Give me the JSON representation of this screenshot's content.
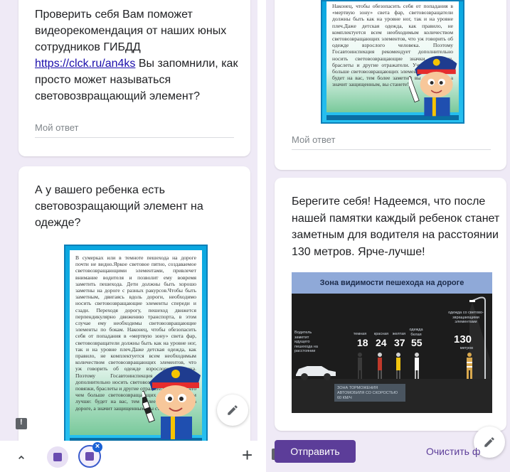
{
  "left_column": {
    "card1": {
      "question_lines": [
        "Проверить себя Вам поможет",
        "видеорекомендация от наших юных",
        "сотрудников ГИБДД"
      ],
      "link": "https://clck.ru/an4ks",
      "link_tail": " Вы запомнили, как",
      "question_rest": [
        "просто может называться",
        "световозвращающий элемент?"
      ],
      "answer_placeholder": "Мой ответ"
    },
    "card2": {
      "question_lines": [
        "А у вашего ребенка есть",
        "световозращающий элемент на",
        "одежде?"
      ]
    }
  },
  "poster": {
    "text_full": "В сумерках или в темноте пешехода на дороге почти не видно.Яркое световое пятно, создаваемое световозвращающими элементами, привлечет внимание водителя и позволит ему вовремя заметить пешехода. Дети должны быть хорошо заметны на дороге с разных ракурсов.Чтобы быть заметным, двигаясь вдоль дороги, необходимо носить световозвращающие элементы спереди и сзади. Переходя дорогу, пешеход движется перпендикулярно движению транспорта, в этом случае ему необходимы световозвращающие элементы по бокам. Наконец, чтобы обезопасить себя от попадания в «мертвую зону» света фар, световозвращатели должны быть как на уровне ног, так и на уровне плеч.Даже детская одежда, как правило, не комплектуется всем необходимым количеством световозвращающих элементов, что уж говорить об одежде взрослого человека. Поэтому Госавтоинспекция рекомендует дополнительно носить световозвращающие значки, повязки, браслеты и другие отражатели. Учтите, что чем больше световозвращающих элементов, тем лучше: будет на вас, тем более заметны вы на дороге, а значит защищенным, вы станете!",
    "text_top_clip": "Наконец, чтобы обезопасить себя от попадания в «мертвую зону» света фар, световозвращатели должны быть как на уровне ног, так и на уровне плеч.Даже детская одежда, как правило, не комплектуется всем необходимым количеством световозвращающих элементов, что уж говорить об одежде взрослого человека. Поэтому Госавтоинспекция рекомендует дополнительно носить световозвращающие значки, повязки, браслеты и другие отражатели. Учтите, что чем больше световозвращающих элементов, тем лучше: будет на вас, тем более заметны вы на дороге, а значит защищенным, вы станете!"
  },
  "right_column": {
    "card_top": {
      "answer_placeholder": "Мой ответ"
    },
    "card_final": {
      "text_lines": [
        "Берегите себя! Надеемся, что после",
        "нашей памятки каждый ребенок станет",
        "заметным для водителя на расстоянии",
        "130 метров. Ярче-лучше!"
      ]
    },
    "zone_image": {
      "title": "Зона видимости пешехода на дороге",
      "driver_label": "Водитель заметит идущего пешехода на расстоянии",
      "columns": [
        {
          "label": "темная",
          "value": "18"
        },
        {
          "label": "красная",
          "value": "24"
        },
        {
          "label": "желтая",
          "value": "37"
        },
        {
          "label": "одежда белая",
          "value": "55"
        }
      ],
      "reflect_label": "одежда со светово-звращающими элементами",
      "reflect_value": "130",
      "reflect_unit": "метров",
      "braking_text": "ЗОНА ТОРМОЖЕНИЯ АВТОМОБИЛЯ СО СКОРОСТЬЮ 60 КМ/Ч"
    },
    "submit_label": "Отправить",
    "clear_label": "Очистить ф"
  },
  "bottom_nav": {
    "tab_badge": "×",
    "add_label": "+"
  },
  "colors": {
    "accent": "#5c3d99",
    "background": "#efeaf6",
    "link": "#1a0dab"
  }
}
